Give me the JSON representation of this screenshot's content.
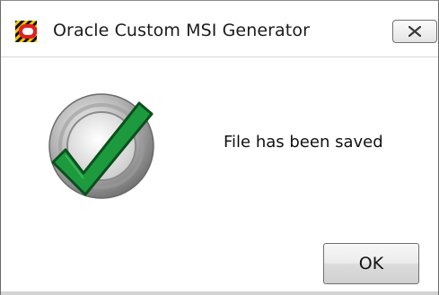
{
  "window": {
    "title": "Oracle Custom MSI Generator",
    "app_icon": "oracle-icon",
    "close_icon": "close-x-icon"
  },
  "dialog": {
    "status_icon": "success-checkmark-icon",
    "message": "File has been saved",
    "ok_label": "OK"
  },
  "colors": {
    "check_green": "#1e9a3e",
    "ring_gray": "#8c8c8c",
    "brand_red": "#e02020",
    "brand_yellow": "#f2c500"
  }
}
